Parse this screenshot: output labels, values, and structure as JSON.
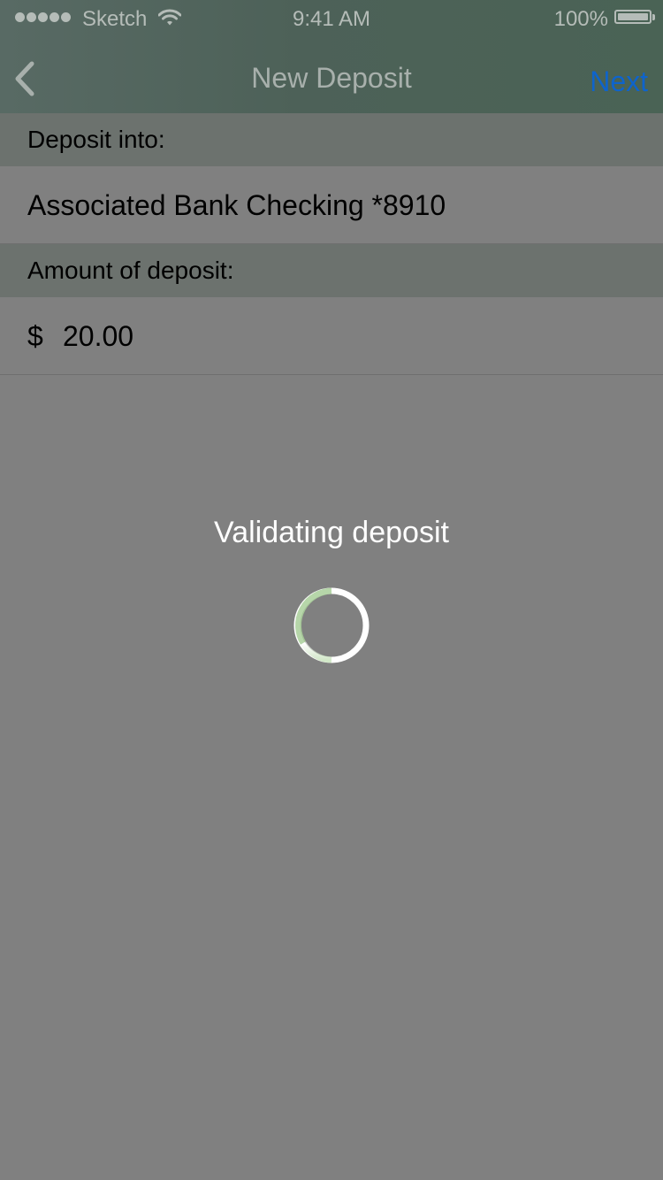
{
  "status_bar": {
    "carrier": "Sketch",
    "time": "9:41 AM",
    "battery": "100%"
  },
  "nav": {
    "title": "New Deposit",
    "next_label": "Next",
    "back_icon": "chevron-left-icon"
  },
  "form": {
    "deposit_into_label": "Deposit into:",
    "account": "Associated Bank Checking *8910",
    "amount_label": "Amount of deposit:",
    "currency": "$",
    "amount": "20.00"
  },
  "overlay": {
    "message": "Validating deposit",
    "spinner_icon": "loading-spinner-icon"
  },
  "colors": {
    "accent": "#0e64cc",
    "overlay": "#808080",
    "header": "#4d6158"
  }
}
